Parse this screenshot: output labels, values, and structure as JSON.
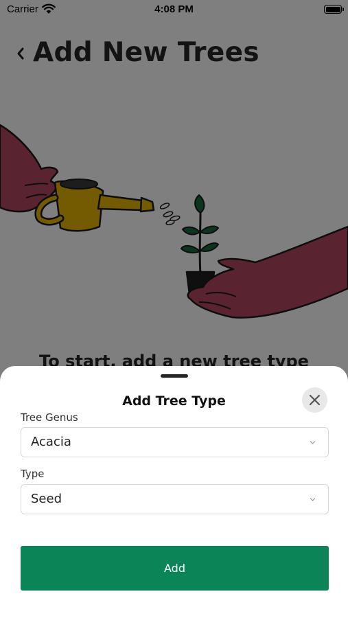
{
  "status_bar": {
    "carrier": "Carrier",
    "time": "4:08 PM"
  },
  "header": {
    "title": "Add New Trees"
  },
  "illustration": {
    "subject": "watering-can-plant-illustration"
  },
  "intro": {
    "text": "To start, add a new tree type"
  },
  "sheet": {
    "title": "Add Tree Type",
    "genus": {
      "label": "Tree Genus",
      "value": "Acacia"
    },
    "type": {
      "label": "Type",
      "value": "Seed"
    },
    "add_label": "Add"
  },
  "colors": {
    "accent": "#0b8457",
    "hands": "#b2485e",
    "watering_can": "#e8b400",
    "leaves": "#1a6b3c",
    "title_text": "#262626"
  },
  "icons": [
    "wifi-icon",
    "battery-icon",
    "back-chevron-icon",
    "close-icon",
    "chevron-down-icon"
  ]
}
